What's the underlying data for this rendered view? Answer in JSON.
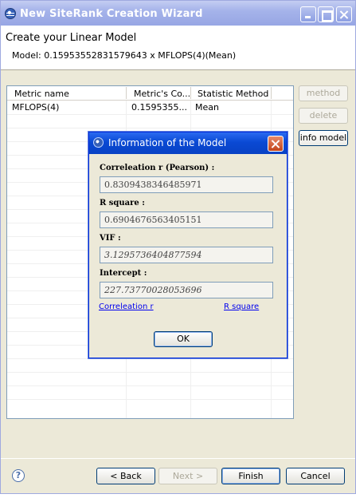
{
  "window": {
    "title": "New SiteRank Creation Wizard"
  },
  "header": {
    "page_title": "Create your Linear Model",
    "model_description": "Model: 0.15953552831579643 x MFLOPS(4)(Mean)"
  },
  "table": {
    "columns": [
      "Metric name",
      "Metric's Co...",
      "Statistic Method"
    ],
    "rows": [
      {
        "metric_name": "MFLOPS(4)",
        "coefficient": "0.1595355...",
        "statistic_method": "Mean"
      }
    ]
  },
  "side_buttons": {
    "method": "method",
    "delete": "delete",
    "info_model": "info model"
  },
  "footer": {
    "help_symbol": "?",
    "back": "< Back",
    "next": "Next >",
    "finish": "Finish",
    "cancel": "Cancel"
  },
  "dialog": {
    "title": "Information of the Model",
    "correlation_label": "Correleation r (Pearson) :",
    "correlation_value": "0.8309438346485971",
    "rsquare_label": "R square :",
    "rsquare_value": "0.6904676563405151",
    "vif_label": "VIF :",
    "vif_value": "3.1295736404877594",
    "intercept_label": "Intercept :",
    "intercept_value": "227.73770028053696",
    "link_correlation": "Correleation r",
    "link_rsquare": "R square",
    "ok": "OK"
  },
  "icons": {
    "app": "eclipse-globe-icon",
    "help": "help-icon"
  },
  "colors": {
    "titlebar_inactive": "#a5b3ea",
    "dialog_titlebar": "#0a49d4",
    "link": "#0000ee"
  }
}
